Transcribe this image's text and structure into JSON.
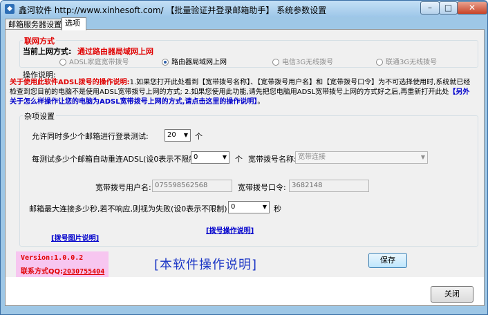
{
  "window": {
    "title": "鑫河软件 http://www.xinhesoft.com/ 【批量验证并登录邮箱助手】 系统参数设置",
    "minimize_glyph": "–",
    "maximize_glyph": "□",
    "close_glyph": "✕"
  },
  "tabs": [
    {
      "label": "邮箱服务器设置"
    },
    {
      "label": "选项"
    }
  ],
  "network": {
    "group_title": "联网方式",
    "current_label": "当前上网方式:",
    "current_value": "通过路由器局域网上网",
    "options": [
      {
        "label": "ADSL家庭宽带拨号",
        "enabled": false
      },
      {
        "label": "路由器局域网上网",
        "enabled": true,
        "selected": true
      },
      {
        "label": "电信3G无线拨号",
        "enabled": false
      },
      {
        "label": "联通3G无线拨号",
        "enabled": false
      }
    ]
  },
  "help": {
    "group_title": "操作说明:",
    "part1": "关于使用此软件ADSL拨号的操作说明:",
    "part2": "1.如果您打开此处看到【宽带拨号名称】、【宽带拨号用户名】和【宽带拨号口令】为不可选择使用时,系统就已经检查到您目前的电脑不是使用ADSL宽带拨号上网的方式; 2.如果您使用此功能,请先把您电脑用ADSL宽带拨号上网的方式好之后,再重新打开此处",
    "part3": "【另外关于怎么样操作让您的电脑为ADSL宽带拨号上网的方式,请点击这里的操作说明】",
    "part4": "。"
  },
  "misc": {
    "group_title": "杂项设置",
    "concurrent_label": "允许同时多少个邮箱进行登录测试:",
    "concurrent_value": "20",
    "concurrent_unit": "个",
    "reconnect_label": "每测试多少个邮箱自动重连ADSL(设0表示不限制)",
    "reconnect_value": "0",
    "reconnect_unit": "个",
    "dial_name_label": "宽带拨号名称:",
    "dial_name_value": "宽带连接",
    "dial_user_label": "宽带拨号用户名:",
    "dial_user_value": "075598562568",
    "dial_password_label": "宽带拨号口令:",
    "dial_password_value": "3682148",
    "timeout_label": "邮箱最大连接多少秒,若不响应,则视为失败(设0表示不限制)",
    "timeout_value": "0",
    "timeout_unit": "秒",
    "dial_op_link": "[拨号操作说明]",
    "dial_pic_link": "[拨号图片说明]"
  },
  "buttons": {
    "save": "保存",
    "close": "关闭"
  },
  "footer": {
    "version": "Version:1.0.0.2",
    "contact_prefix": "联系方式QQ:",
    "contact_qq": "2030755404",
    "manual": "[本软件操作说明]"
  },
  "colors": {
    "accent_red": "#e00000",
    "link_blue": "#0000cc",
    "title_bar": "#9dc6e8",
    "version_bg": "#f7c6f0"
  }
}
